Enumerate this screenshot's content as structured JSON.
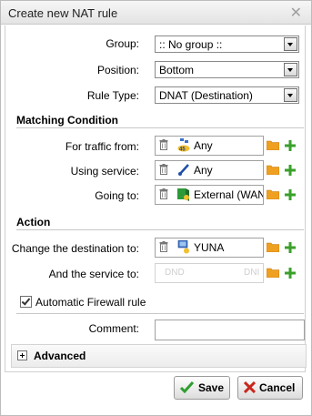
{
  "window": {
    "title": "Create new NAT rule",
    "close_glyph": "✕"
  },
  "form": {
    "group": {
      "label": "Group:",
      "value": ":: No group ::"
    },
    "position": {
      "label": "Position:",
      "value": "Bottom"
    },
    "rule_type": {
      "label": "Rule Type:",
      "value": "DNAT (Destination)"
    }
  },
  "matching": {
    "heading": "Matching Condition",
    "traffic_from": {
      "label": "For traffic from:",
      "value": "Any",
      "icon": "network-any-icon"
    },
    "using_service": {
      "label": "Using service:",
      "value": "Any",
      "icon": "service-any-icon"
    },
    "going_to": {
      "label": "Going to:",
      "value": "External (WAN",
      "icon": "external-wan-icon"
    }
  },
  "action": {
    "heading": "Action",
    "change_destination": {
      "label": "Change the destination to:",
      "value": "YUNA",
      "icon": "host-icon"
    },
    "service_to": {
      "label": "And the service to:",
      "dnd_left": "DND",
      "dnd_right": "DNI"
    }
  },
  "auto_firewall": {
    "label": "Automatic Firewall rule",
    "checked": true
  },
  "comment": {
    "label": "Comment:",
    "value": ""
  },
  "advanced": {
    "label": "Advanced"
  },
  "buttons": {
    "save": "Save",
    "cancel": "Cancel"
  },
  "colors": {
    "folder": "#f0a020",
    "plus": "#3aa02a",
    "save_check": "#2f9e2f",
    "cancel_x": "#c8281e"
  }
}
